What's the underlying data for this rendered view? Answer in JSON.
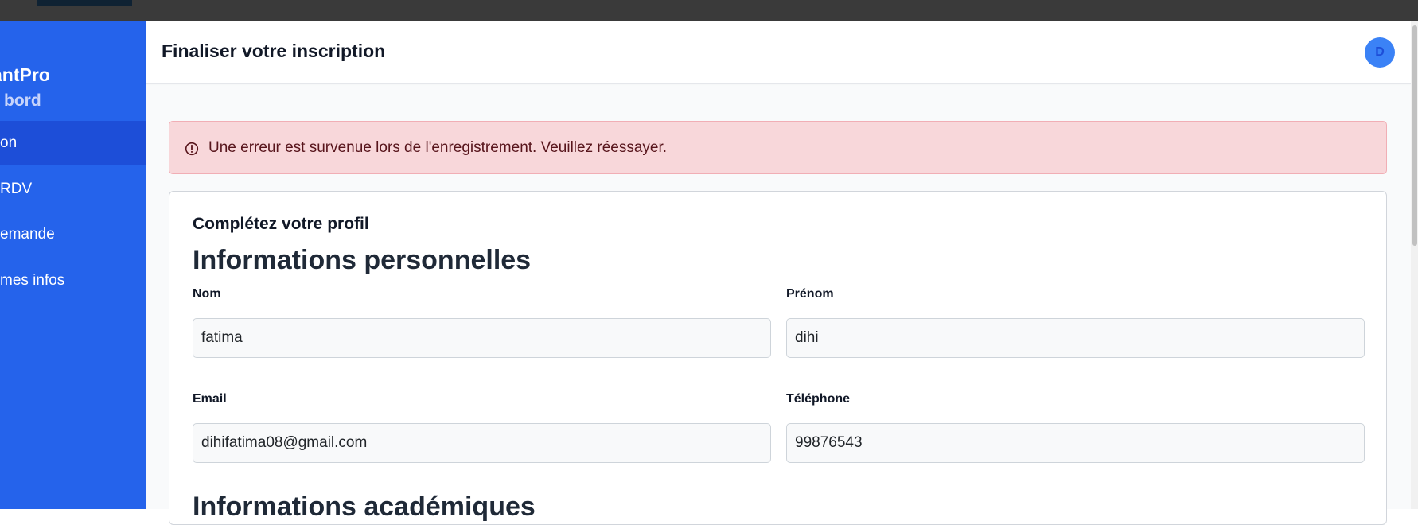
{
  "sidebar": {
    "brand": "antPro",
    "items": [
      {
        "label": "bord",
        "state": "muted"
      },
      {
        "label": "on",
        "state": "active"
      },
      {
        "label": "RDV",
        "state": "normal"
      },
      {
        "label": "emande",
        "state": "normal"
      },
      {
        "label": "mes infos",
        "state": "normal"
      }
    ]
  },
  "header": {
    "title": "Finaliser votre inscription",
    "avatar_initial": "D"
  },
  "alert": {
    "icon": "exclamation-circle-icon",
    "message": "Une erreur est survenue lors de l'enregistrement. Veuillez réessayer."
  },
  "form": {
    "subtitle": "Complétez votre profil",
    "personal_section": "Informations personnelles",
    "academic_section": "Informations académiques",
    "fields": {
      "nom": {
        "label": "Nom",
        "value": "fatima"
      },
      "prenom": {
        "label": "Prénom",
        "value": "dihi"
      },
      "email": {
        "label": "Email",
        "value": "dihifatima08@gmail.com"
      },
      "telephone": {
        "label": "Téléphone",
        "value": "99876543"
      }
    }
  },
  "colors": {
    "sidebar": "#2563eb",
    "sidebar_active": "#1d4ed8",
    "alert_bg": "#f8d7da",
    "alert_text": "#58151c",
    "avatar": "#3b82f6"
  }
}
